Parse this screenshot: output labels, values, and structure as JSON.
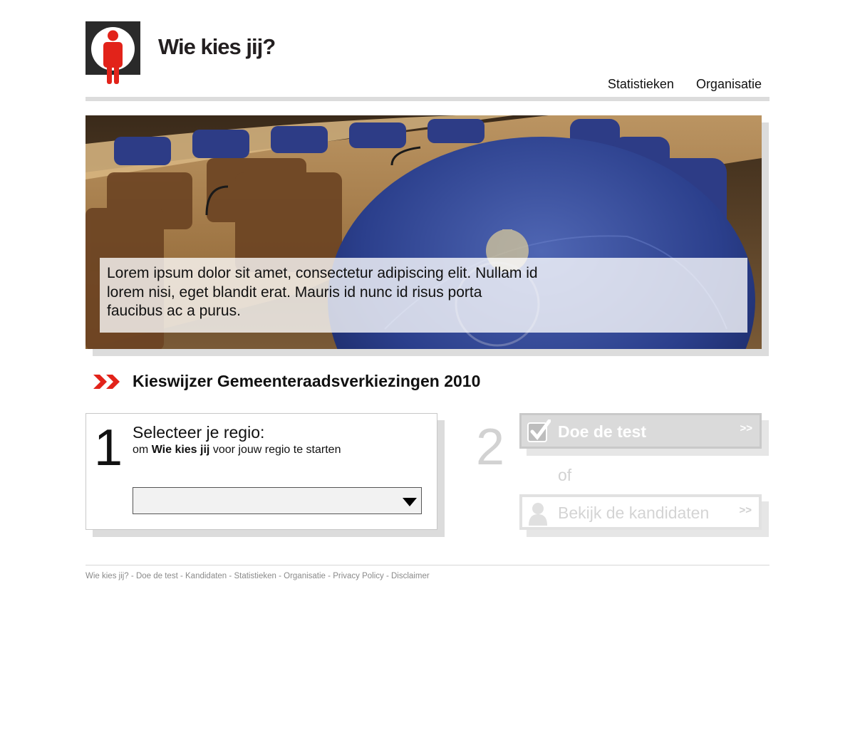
{
  "site": {
    "title": "Wie kies jij?"
  },
  "nav": {
    "items": [
      {
        "label": "Statistieken"
      },
      {
        "label": "Organisatie"
      }
    ]
  },
  "hero": {
    "caption": "Lorem ipsum dolor sit amet, consectetur adipiscing elit. Nullam id lorem nisi, eget blandit erat. Mauris id nunc id risus porta faucibus ac a purus."
  },
  "section": {
    "title": "Kieswijzer Gemeenteraadsverkiezingen 2010"
  },
  "step1": {
    "number": "1",
    "heading": "Selecteer je regio:",
    "sub_prefix": "om",
    "sub_bold": "Wie kies jij",
    "sub_suffix": "voor jouw regio te starten",
    "select_value": ""
  },
  "step2": {
    "number": "2",
    "test_button": "Doe de test",
    "or_label": "of",
    "candidates_button": "Bekijk de kandidaten",
    "chevron": ">>"
  },
  "footer": {
    "separator": " - ",
    "links": [
      "Wie kies jij?",
      "Doe de test",
      "Kandidaten",
      "Statistieken",
      "Organisatie",
      "Privacy Policy",
      "Disclaimer"
    ]
  },
  "colors": {
    "brand_red": "#e2231a",
    "logo_bg": "#2a2a2a",
    "disabled_gray": "#d2d2d2"
  },
  "icons": {
    "logo": "person-icon",
    "section": "double-chevron-icon",
    "test": "checkmark-icon",
    "candidates": "person-silhouette-icon"
  }
}
